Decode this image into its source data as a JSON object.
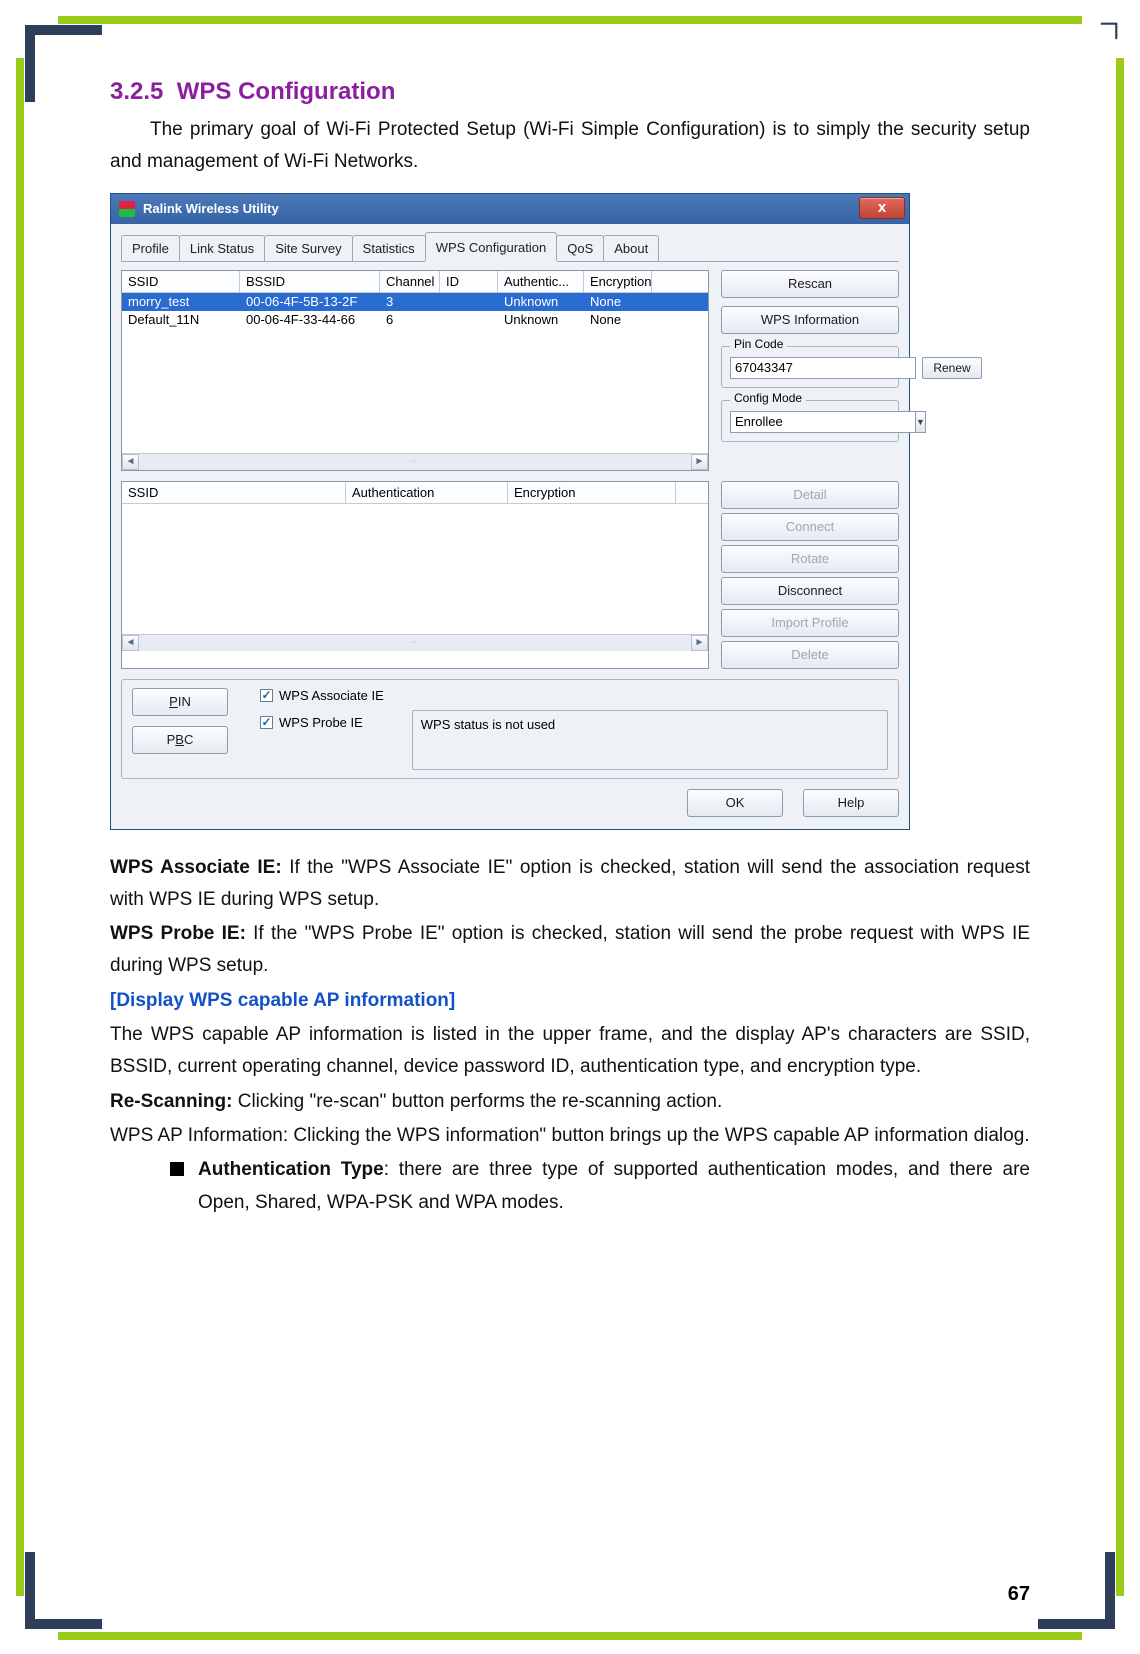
{
  "section": {
    "number": "3.2.5",
    "title": "WPS Configuration"
  },
  "intro_para": "The primary goal of Wi-Fi Protected Setup (Wi-Fi Simple Configuration) is to simply the security setup and management of Wi-Fi Networks.",
  "dialog": {
    "title": "Ralink Wireless Utility",
    "close_glyph": "x",
    "tabs": [
      "Profile",
      "Link Status",
      "Site Survey",
      "Statistics",
      "WPS Configuration",
      "QoS",
      "About"
    ],
    "active_tab_index": 4,
    "upper_table": {
      "columns": [
        "SSID",
        "BSSID",
        "Channel",
        "ID",
        "Authentic...",
        "Encryption"
      ],
      "rows": [
        {
          "ssid": "morry_test",
          "bssid": "00-06-4F-5B-13-2F",
          "channel": "3",
          "id": "",
          "auth": "Unknown",
          "enc": "None",
          "selected": true
        },
        {
          "ssid": "Default_11N",
          "bssid": "00-06-4F-33-44-66",
          "channel": "6",
          "id": "",
          "auth": "Unknown",
          "enc": "None",
          "selected": false
        }
      ]
    },
    "right_panel": {
      "rescan": "Rescan",
      "wps_info": "WPS Information",
      "pin_legend": "Pin Code",
      "pin_value": "67043347",
      "renew": "Renew",
      "config_legend": "Config Mode",
      "config_value": "Enrollee"
    },
    "lower_table": {
      "columns": [
        "SSID",
        "Authentication",
        "Encryption"
      ]
    },
    "right_panel2": {
      "detail": "Detail",
      "connect": "Connect",
      "rotate": "Rotate",
      "disconnect": "Disconnect",
      "import": "Import Profile",
      "delete": "Delete"
    },
    "bottom": {
      "pin_btn": "PIN",
      "pbc_btn": "PBC",
      "chk_assoc": "WPS Associate IE",
      "chk_probe": "WPS Probe IE",
      "status": "WPS status is not used"
    },
    "footer": {
      "ok": "OK",
      "help": "Help"
    }
  },
  "para_assoc": {
    "label": "WPS Associate IE:",
    "text": " If the \"WPS Associate IE\" option is checked, station will send the association request with WPS IE during WPS setup."
  },
  "para_probe": {
    "label": "WPS Probe IE:",
    "text": " If the \"WPS Probe IE\" option is checked, station will send the probe request with WPS IE during WPS setup."
  },
  "display_heading": "[Display WPS capable AP information]",
  "display_para": "The WPS capable AP information is listed in the upper frame, and the display AP's characters are SSID, BSSID, current operating channel, device password ID, authentication type, and encryption type.",
  "rescan_para": {
    "label": "Re-Scanning:",
    "text": " Clicking \"re-scan\" button performs the re-scanning action."
  },
  "apinfo_para": "WPS AP Information: Clicking the WPS information\" button brings up the WPS capable AP information dialog.",
  "bullet_auth": {
    "label": "Authentication Type",
    "text": ": there are three type of supported authentication modes, and there are Open, Shared, WPA-PSK and WPA modes."
  },
  "page_number": "67"
}
